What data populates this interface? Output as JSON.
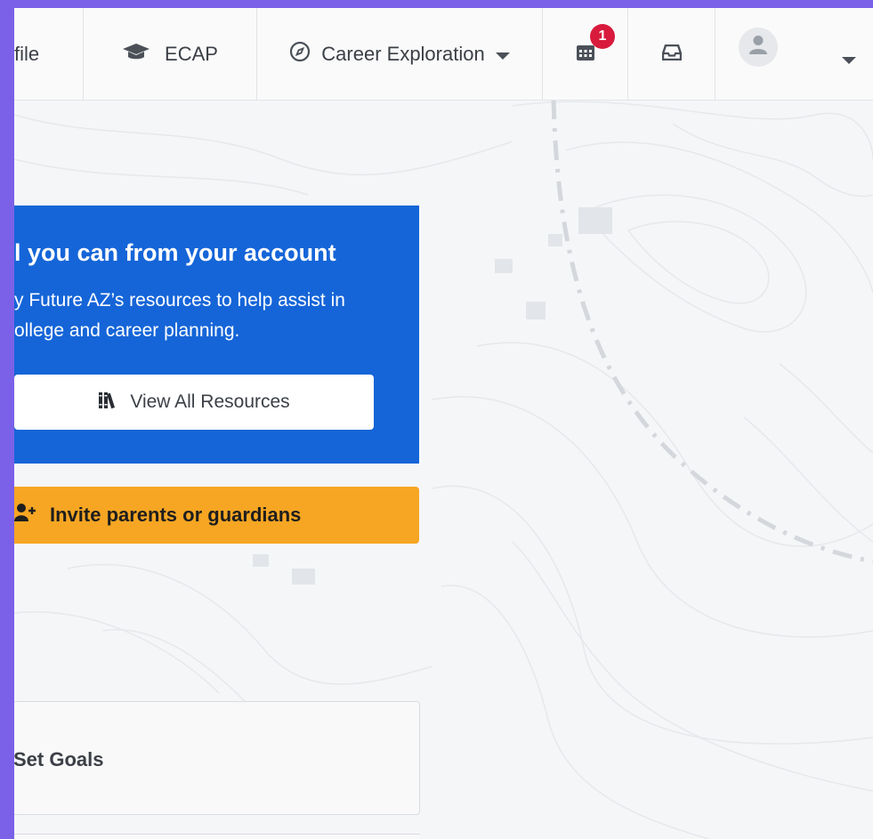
{
  "nav": {
    "profile_label": "file",
    "ecap_label": "ECAP",
    "career_label": "Career Exploration",
    "calendar_badge": "1"
  },
  "resources": {
    "title": "l you can from your account",
    "desc_line1": "y Future AZ’s resources to help assist in",
    "desc_line2": "ollege and career planning.",
    "button_label": "View All Resources"
  },
  "invite": {
    "label": "Invite parents or guardians"
  },
  "goals": {
    "label": "Set Goals"
  },
  "colors": {
    "primary_blue": "#1565d8",
    "invite_orange": "#f6a623",
    "badge_red": "#d81b3c",
    "outer_purple": "#7b61e8"
  },
  "icons": [
    "graduation-cap-icon",
    "compass-icon",
    "caret-down-icon",
    "calendar-icon",
    "inbox-icon",
    "user-icon",
    "books-icon",
    "user-plus-icon"
  ]
}
